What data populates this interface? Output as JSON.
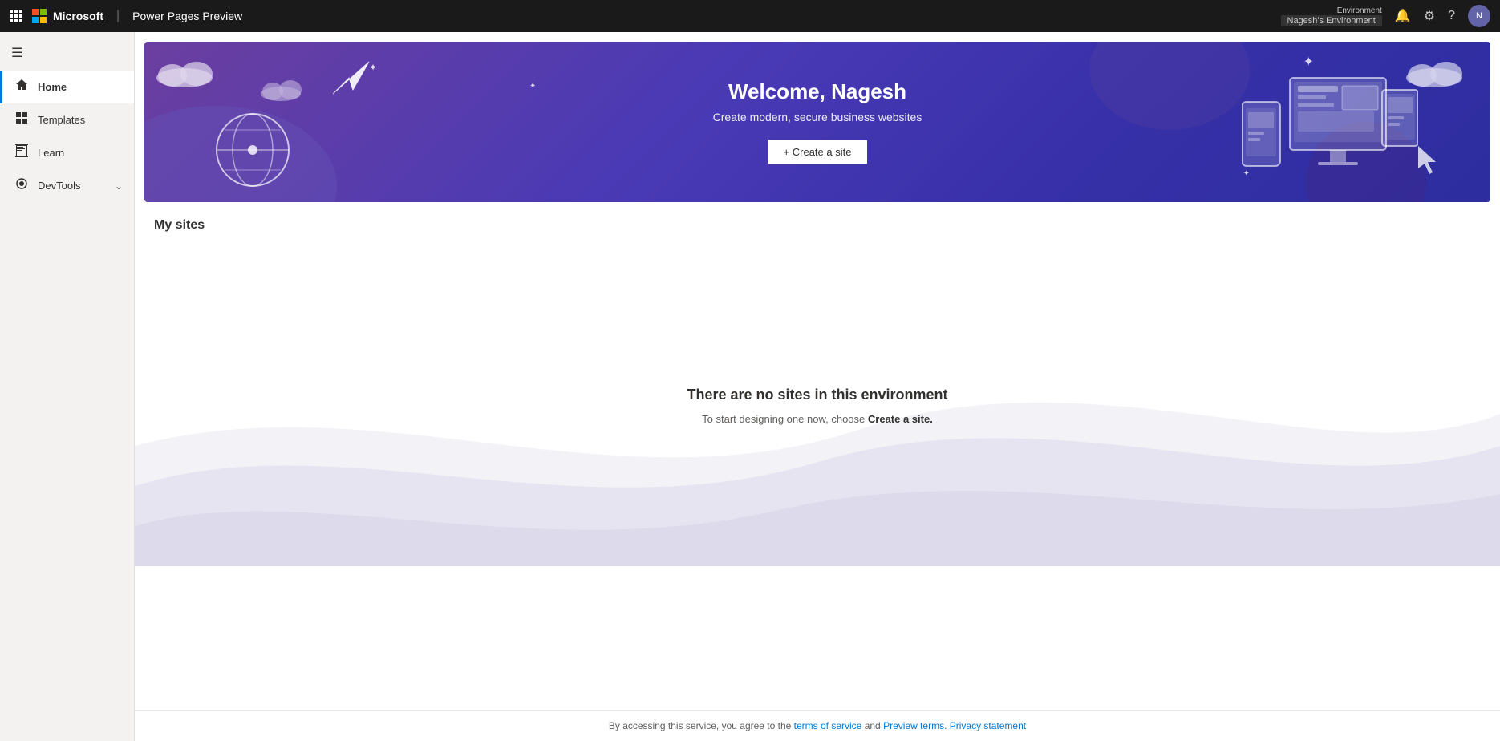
{
  "topbar": {
    "title": "Power Pages Preview",
    "environment_label": "Environment",
    "environment_value": "Nagesh's Environment",
    "avatar_initials": "N"
  },
  "sidebar": {
    "hamburger_icon": "☰",
    "items": [
      {
        "id": "home",
        "label": "Home",
        "icon": "⌂",
        "active": true
      },
      {
        "id": "templates",
        "label": "Templates",
        "icon": "⊞",
        "active": false
      },
      {
        "id": "learn",
        "label": "Learn",
        "icon": "📖",
        "active": false
      },
      {
        "id": "devtools",
        "label": "DevTools",
        "icon": "⚙",
        "active": false,
        "hasChevron": true
      }
    ]
  },
  "hero": {
    "title": "Welcome, Nagesh",
    "subtitle": "Create modern, secure business websites",
    "cta_label": "+ Create a site"
  },
  "my_sites": {
    "section_title": "My sites",
    "empty_title": "There are no sites in this environment",
    "empty_desc_prefix": "To start designing one now, choose ",
    "empty_desc_link": "Create a site.",
    "empty_desc_suffix": ""
  },
  "footer": {
    "prefix": "By accessing this service, you agree to the ",
    "tos_label": "terms of service",
    "tos_href": "#",
    "and": " and ",
    "preview_label": "Preview terms",
    "preview_href": "#",
    "period": ". ",
    "privacy_label": "Privacy statement",
    "privacy_href": "#"
  }
}
